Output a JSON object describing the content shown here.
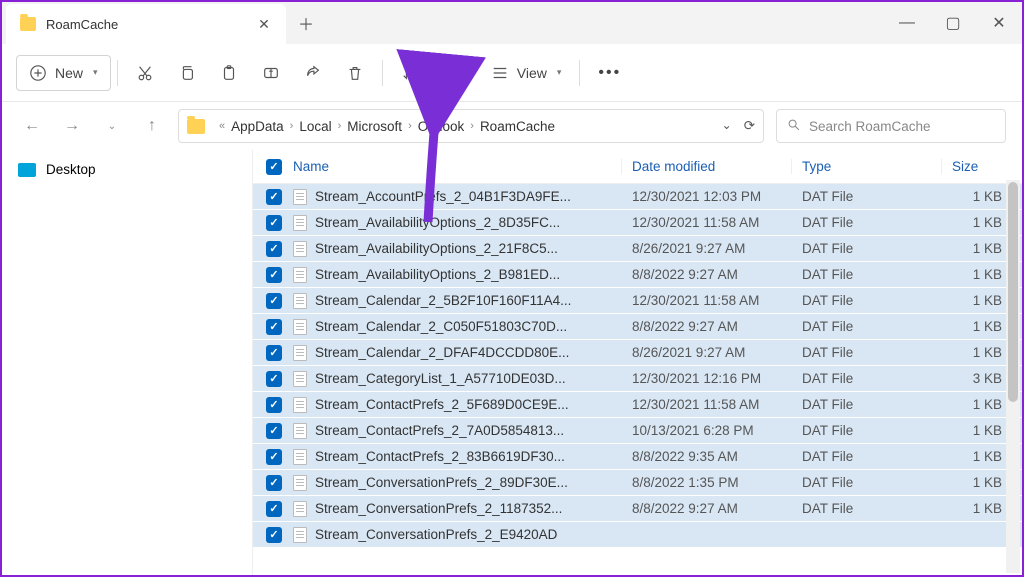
{
  "window": {
    "tab_title": "RoamCache",
    "controls": {
      "min": "—",
      "max": "▢",
      "close": "✕"
    }
  },
  "toolbar": {
    "new_label": "New",
    "sort_label": "Sort",
    "view_label": "View"
  },
  "breadcrumb": {
    "items": [
      "AppData",
      "Local",
      "Microsoft",
      "Outlook",
      "RoamCache"
    ],
    "prefix": "«"
  },
  "search": {
    "placeholder": "Search RoamCache"
  },
  "sidebar": {
    "desktop": "Desktop"
  },
  "columns": {
    "name": "Name",
    "date": "Date modified",
    "type": "Type",
    "size": "Size"
  },
  "files": [
    {
      "name": "Stream_AccountPrefs_2_04B1F3DA9FE...",
      "date": "12/30/2021 12:03 PM",
      "type": "DAT File",
      "size": "1 KB"
    },
    {
      "name": "Stream_AvailabilityOptions_2_8D35FC...",
      "date": "12/30/2021 11:58 AM",
      "type": "DAT File",
      "size": "1 KB"
    },
    {
      "name": "Stream_AvailabilityOptions_2_21F8C5...",
      "date": "8/26/2021 9:27 AM",
      "type": "DAT File",
      "size": "1 KB"
    },
    {
      "name": "Stream_AvailabilityOptions_2_B981ED...",
      "date": "8/8/2022 9:27 AM",
      "type": "DAT File",
      "size": "1 KB"
    },
    {
      "name": "Stream_Calendar_2_5B2F10F160F11A4...",
      "date": "12/30/2021 11:58 AM",
      "type": "DAT File",
      "size": "1 KB"
    },
    {
      "name": "Stream_Calendar_2_C050F51803C70D...",
      "date": "8/8/2022 9:27 AM",
      "type": "DAT File",
      "size": "1 KB"
    },
    {
      "name": "Stream_Calendar_2_DFAF4DCCDD80E...",
      "date": "8/26/2021 9:27 AM",
      "type": "DAT File",
      "size": "1 KB"
    },
    {
      "name": "Stream_CategoryList_1_A57710DE03D...",
      "date": "12/30/2021 12:16 PM",
      "type": "DAT File",
      "size": "3 KB"
    },
    {
      "name": "Stream_ContactPrefs_2_5F689D0CE9E...",
      "date": "12/30/2021 11:58 AM",
      "type": "DAT File",
      "size": "1 KB"
    },
    {
      "name": "Stream_ContactPrefs_2_7A0D5854813...",
      "date": "10/13/2021 6:28 PM",
      "type": "DAT File",
      "size": "1 KB"
    },
    {
      "name": "Stream_ContactPrefs_2_83B6619DF30...",
      "date": "8/8/2022 9:35 AM",
      "type": "DAT File",
      "size": "1 KB"
    },
    {
      "name": "Stream_ConversationPrefs_2_89DF30E...",
      "date": "8/8/2022 1:35 PM",
      "type": "DAT File",
      "size": "1 KB"
    },
    {
      "name": "Stream_ConversationPrefs_2_1187352...",
      "date": "8/8/2022 9:27 AM",
      "type": "DAT File",
      "size": "1 KB"
    },
    {
      "name": "Stream_ConversationPrefs_2_E9420AD",
      "date": "",
      "type": "",
      "size": ""
    }
  ]
}
